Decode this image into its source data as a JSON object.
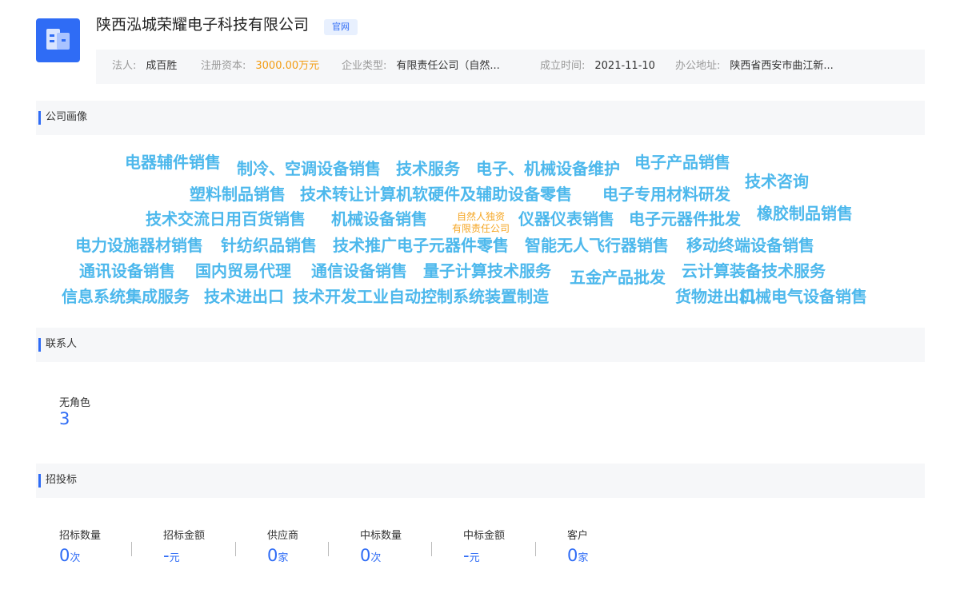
{
  "company": {
    "name": "陕西泓城荣耀电子科技有限公司",
    "badge": "官网"
  },
  "info": [
    {
      "key": "法人:",
      "value": "成百胜"
    },
    {
      "key": "注册资本:",
      "value": "3000.00万元"
    },
    {
      "key": "企业类型:",
      "value": "有限责任公司（自然..."
    },
    {
      "key": "成立时间:",
      "value": "2021-11-10"
    },
    {
      "key": "办公地址:",
      "value": "陕西省西安市曲江新..."
    }
  ],
  "sections": {
    "portrait": "公司画像",
    "contacts": "联系人",
    "bidding": "招投标"
  },
  "word_cloud": {
    "center": [
      "自然人独资",
      "有限责任公司"
    ],
    "words": [
      "电器辅件销售",
      "制冷、空调设备销售",
      "技术服务",
      "电子、机械设备维护",
      "电子产品销售",
      "技术咨询",
      "塑料制品销售",
      "技术转让",
      "计算机软硬件及辅助设备零售",
      "电子专用材料研发",
      "技术交流",
      "日用百货销售",
      "机械设备销售",
      "仪器仪表销售",
      "电子元器件批发",
      "橡胶制品销售",
      "电力设施器材销售",
      "针纺织品销售",
      "技术推广",
      "电子元器件零售",
      "智能无人飞行器销售",
      "移动终端设备销售",
      "通讯设备销售",
      "国内贸易代理",
      "通信设备销售",
      "量子计算技术服务",
      "五金产品批发",
      "云计算装备技术服务",
      "信息系统集成服务",
      "技术进出口",
      "技术开发",
      "工业自动控制系统装置制造",
      "货物进出口",
      "机械电气设备销售"
    ]
  },
  "contacts": {
    "label": "无角色",
    "value": "3"
  },
  "bidding": [
    {
      "label": "招标数量",
      "value": "0",
      "unit": "次"
    },
    {
      "label": "招标金额",
      "value": "-",
      "unit": "元"
    },
    {
      "label": "供应商",
      "value": "0",
      "unit": "家"
    },
    {
      "label": "中标数量",
      "value": "0",
      "unit": "次"
    },
    {
      "label": "中标金额",
      "value": "-",
      "unit": "元"
    },
    {
      "label": "客户",
      "value": "0",
      "unit": "家"
    }
  ],
  "colors": {
    "accent": "#2f6cf5",
    "cloud": "#4db8ec",
    "capital": "#f39c12",
    "center": "#f5a623"
  }
}
